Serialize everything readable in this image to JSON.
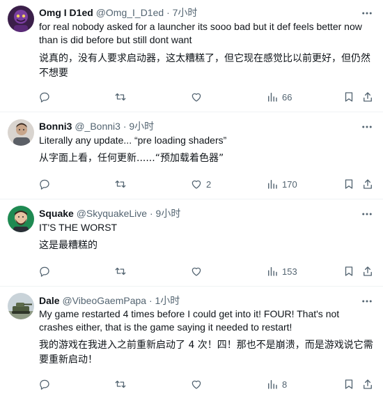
{
  "tweets": [
    {
      "name": "Omg I D1ed",
      "handle": "@Omg_I_D1ed",
      "sep": "·",
      "time": "7小时",
      "text_lines": [
        "for real nobody asked for a launcher its sooo bad but it def feels better now",
        "than is did before but still dont want"
      ],
      "translation_lines": [
        "说真的，没有人要求启动器，这太糟糕了，但它现在感觉比以前更好，但仍然",
        "不想要"
      ],
      "replies": "",
      "retweets": "",
      "likes": "",
      "views": "66"
    },
    {
      "name": "Bonni3",
      "handle": "@_Bonni3",
      "sep": "·",
      "time": "9小时",
      "text_lines": [
        "Literally any update... “pre loading shaders”"
      ],
      "translation_lines": [
        "从字面上看，任何更新......“预加载着色器”"
      ],
      "replies": "",
      "retweets": "",
      "likes": "2",
      "views": "170"
    },
    {
      "name": "Squake",
      "handle": "@SkyquakeLive",
      "sep": "·",
      "time": "9小时",
      "text_lines": [
        "IT'S THE WORST"
      ],
      "translation_lines": [
        "这是最糟糕的"
      ],
      "replies": "",
      "retweets": "",
      "likes": "",
      "views": "153"
    },
    {
      "name": "Dale",
      "handle": "@VibeoGaemPapa",
      "sep": "·",
      "time": "1小时",
      "text_lines": [
        "My game restarted 4 times before I could get into it! FOUR! That's not",
        "crashes either, that is the game saying it needed to restart!"
      ],
      "translation_lines": [
        "我的游戏在我进入之前重新启动了 4 次！四！那也不是崩溃，而是游戏说它需",
        "要重新启动！"
      ],
      "replies": "",
      "retweets": "",
      "likes": "",
      "views": "8"
    }
  ],
  "icons": {
    "avatar_0": "purple-cartoon-avatar",
    "avatar_1": "person-photo-avatar",
    "avatar_2": "bearded-man-avatar",
    "avatar_3": "tank-avatar",
    "more": "more-dots-icon",
    "reply": "reply-bubble-icon",
    "retweet": "retweet-icon",
    "like": "heart-icon",
    "views": "views-bars-icon",
    "bookmark": "bookmark-icon",
    "share": "share-icon"
  },
  "colors": {
    "text": "#0f1419",
    "secondary": "#536471",
    "divider": "#eff3f4"
  }
}
